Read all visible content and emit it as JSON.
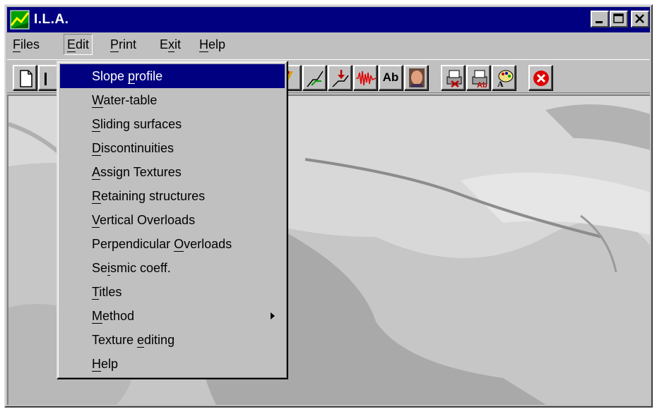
{
  "window": {
    "title": "I.L.A.",
    "icon": "app-logo-icon",
    "controls": [
      "minimize-icon",
      "maximize-icon",
      "close-icon"
    ]
  },
  "menubar": {
    "items": [
      {
        "label": "Files",
        "mnemonic": "F",
        "rest": "iles"
      },
      {
        "label": "Edit",
        "mnemonic": "E",
        "rest": "dit"
      },
      {
        "label": "Print",
        "mnemonic": "P",
        "rest": "rint"
      },
      {
        "label": "Exit",
        "mnemonic_pre": "E",
        "mnemonic": "x",
        "rest": "it"
      },
      {
        "label": "Help",
        "mnemonic": "H",
        "rest": "elp"
      }
    ]
  },
  "toolbar": {
    "text_button_label": "Ab",
    "icons": [
      "new-document-icon",
      "open-icon",
      "slope-profile-icon",
      "line-chart-icon",
      "load-arrow-icon",
      "seismic-icon",
      "text-icon",
      "portrait-icon",
      "print-icon",
      "print-text-icon",
      "palette-icon",
      "exit-icon"
    ]
  },
  "edit_menu": {
    "items": [
      {
        "pre": "Slope ",
        "u": "p",
        "post": "rofile",
        "selected": true
      },
      {
        "pre": "",
        "u": "W",
        "post": "ater-table"
      },
      {
        "pre": "",
        "u": "S",
        "post": "liding surfaces"
      },
      {
        "pre": "",
        "u": "D",
        "post": "iscontinuities"
      },
      {
        "pre": "",
        "u": "A",
        "post": "ssign Textures"
      },
      {
        "pre": "",
        "u": "R",
        "post": "etaining structures"
      },
      {
        "pre": "",
        "u": "V",
        "post": "ertical Overloads"
      },
      {
        "pre": "Perpendicular ",
        "u": "O",
        "post": "verloads"
      },
      {
        "pre": "Se",
        "u": "i",
        "post": "smic coeff."
      },
      {
        "pre": "",
        "u": "T",
        "post": "itles"
      },
      {
        "pre": "",
        "u": "M",
        "post": "ethod",
        "submenu": true
      },
      {
        "pre": "Texture ",
        "u": "e",
        "post": "diting"
      },
      {
        "pre": "",
        "u": "H",
        "post": "elp"
      }
    ]
  },
  "colors": {
    "titlebar": "#000080",
    "face": "#c0c0c0",
    "selection": "#000080"
  }
}
